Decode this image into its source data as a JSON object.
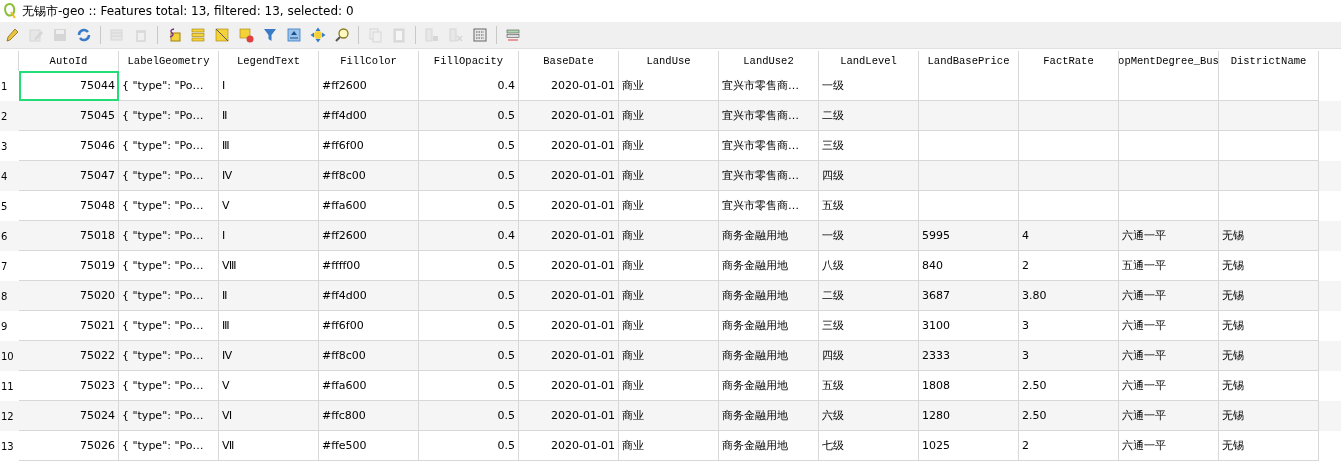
{
  "window": {
    "title": "无锡市-geo :: Features total: 13, filtered: 13, selected: 0"
  },
  "toolbar": [
    {
      "items": [
        {
          "kind": "pencil",
          "disabled": false
        },
        {
          "kind": "multiedit",
          "disabled": true
        },
        {
          "kind": "save",
          "disabled": true
        },
        {
          "kind": "reload",
          "disabled": false
        }
      ]
    },
    {
      "items": [
        {
          "kind": "addrow",
          "disabled": true
        },
        {
          "kind": "trash",
          "disabled": true
        }
      ]
    },
    {
      "items": [
        {
          "kind": "expression",
          "disabled": false
        },
        {
          "kind": "selectall",
          "disabled": false
        },
        {
          "kind": "invert",
          "disabled": false
        },
        {
          "kind": "deselect",
          "disabled": false
        },
        {
          "kind": "filter",
          "disabled": false
        },
        {
          "kind": "totop",
          "disabled": false
        },
        {
          "kind": "pan",
          "disabled": false
        },
        {
          "kind": "zoom",
          "disabled": false
        }
      ]
    },
    {
      "items": [
        {
          "kind": "copy",
          "disabled": true
        },
        {
          "kind": "paste",
          "disabled": true
        }
      ]
    },
    {
      "items": [
        {
          "kind": "newfield",
          "disabled": true
        },
        {
          "kind": "delfield",
          "disabled": true
        },
        {
          "kind": "calculator",
          "disabled": false
        }
      ]
    },
    {
      "items": [
        {
          "kind": "format",
          "disabled": false
        }
      ]
    }
  ],
  "table": {
    "columns": [
      "AutoId",
      "LabelGeometry",
      "LegendText",
      "FillColor",
      "FillOpacity",
      "BaseDate",
      "LandUse",
      "LandUse2",
      "LandLevel",
      "LandBasePrice",
      "FactRate",
      "opMentDegree_Bus",
      "DistrictName"
    ],
    "rows": [
      {
        "number": "1",
        "focused": true,
        "cells": [
          "75044",
          "{ \"type\": \"Po…",
          "Ⅰ",
          "#ff2600",
          "0.4",
          "2020-01-01",
          "商业",
          "宜兴市零售商…",
          "一级",
          "",
          "",
          "",
          ""
        ]
      },
      {
        "number": "2",
        "focused": false,
        "cells": [
          "75045",
          "{ \"type\": \"Po…",
          "Ⅱ",
          "#ff4d00",
          "0.5",
          "2020-01-01",
          "商业",
          "宜兴市零售商…",
          "二级",
          "",
          "",
          "",
          ""
        ]
      },
      {
        "number": "3",
        "focused": false,
        "cells": [
          "75046",
          "{ \"type\": \"Po…",
          "Ⅲ",
          "#ff6f00",
          "0.5",
          "2020-01-01",
          "商业",
          "宜兴市零售商…",
          "三级",
          "",
          "",
          "",
          ""
        ]
      },
      {
        "number": "4",
        "focused": false,
        "cells": [
          "75047",
          "{ \"type\": \"Po…",
          "Ⅳ",
          "#ff8c00",
          "0.5",
          "2020-01-01",
          "商业",
          "宜兴市零售商…",
          "四级",
          "",
          "",
          "",
          ""
        ]
      },
      {
        "number": "5",
        "focused": false,
        "cells": [
          "75048",
          "{ \"type\": \"Po…",
          "Ⅴ",
          "#ffa600",
          "0.5",
          "2020-01-01",
          "商业",
          "宜兴市零售商…",
          "五级",
          "",
          "",
          "",
          ""
        ]
      },
      {
        "number": "6",
        "focused": false,
        "cells": [
          "75018",
          "{ \"type\": \"Po…",
          "Ⅰ",
          "#ff2600",
          "0.4",
          "2020-01-01",
          "商业",
          "商务金融用地",
          "一级",
          "5995",
          "4",
          "六通一平",
          "无锡"
        ]
      },
      {
        "number": "7",
        "focused": false,
        "cells": [
          "75019",
          "{ \"type\": \"Po…",
          "Ⅷ",
          "#ffff00",
          "0.5",
          "2020-01-01",
          "商业",
          "商务金融用地",
          "八级",
          "840",
          "2",
          "五通一平",
          "无锡"
        ]
      },
      {
        "number": "8",
        "focused": false,
        "cells": [
          "75020",
          "{ \"type\": \"Po…",
          "Ⅱ",
          "#ff4d00",
          "0.5",
          "2020-01-01",
          "商业",
          "商务金融用地",
          "二级",
          "3687",
          "3.80",
          "六通一平",
          "无锡"
        ]
      },
      {
        "number": "9",
        "focused": false,
        "cells": [
          "75021",
          "{ \"type\": \"Po…",
          "Ⅲ",
          "#ff6f00",
          "0.5",
          "2020-01-01",
          "商业",
          "商务金融用地",
          "三级",
          "3100",
          "3",
          "六通一平",
          "无锡"
        ]
      },
      {
        "number": "10",
        "focused": false,
        "cells": [
          "75022",
          "{ \"type\": \"Po…",
          "Ⅳ",
          "#ff8c00",
          "0.5",
          "2020-01-01",
          "商业",
          "商务金融用地",
          "四级",
          "2333",
          "3",
          "六通一平",
          "无锡"
        ]
      },
      {
        "number": "11",
        "focused": false,
        "cells": [
          "75023",
          "{ \"type\": \"Po…",
          "Ⅴ",
          "#ffa600",
          "0.5",
          "2020-01-01",
          "商业",
          "商务金融用地",
          "五级",
          "1808",
          "2.50",
          "六通一平",
          "无锡"
        ]
      },
      {
        "number": "12",
        "focused": false,
        "cells": [
          "75024",
          "{ \"type\": \"Po…",
          "Ⅵ",
          "#ffc800",
          "0.5",
          "2020-01-01",
          "商业",
          "商务金融用地",
          "六级",
          "1280",
          "2.50",
          "六通一平",
          "无锡"
        ]
      },
      {
        "number": "13",
        "focused": false,
        "cells": [
          "75026",
          "{ \"type\": \"Po…",
          "Ⅶ",
          "#ffe500",
          "0.5",
          "2020-01-01",
          "商业",
          "商务金融用地",
          "七级",
          "1025",
          "2",
          "六通一平",
          "无锡"
        ]
      }
    ]
  }
}
